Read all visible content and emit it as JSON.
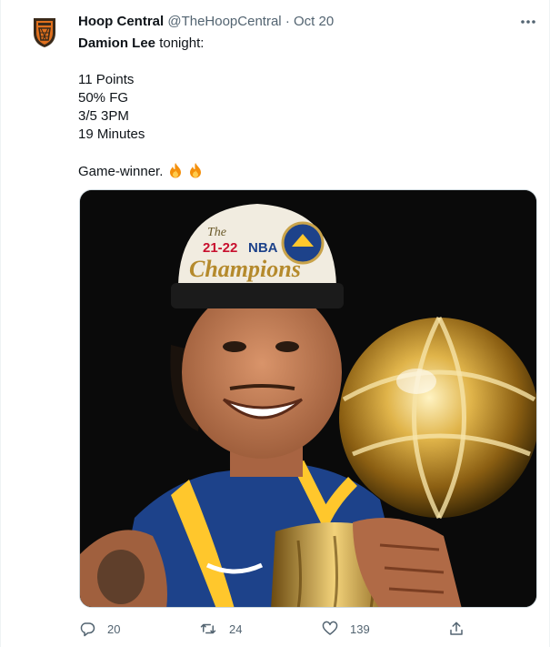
{
  "tweet": {
    "author_name": "Hoop Central",
    "handle": "@TheHoopCentral",
    "separator": "·",
    "date": "Oct 20",
    "mention": "Damion Lee",
    "intro_rest": " tonight:",
    "stats": [
      "11 Points",
      "50% FG",
      "3/5 3PM",
      "19 Minutes"
    ],
    "closing": "Game-winner.",
    "media": {
      "cap_line1": "The",
      "cap_line2": "21-22",
      "cap_line3": "NBA",
      "cap_script": "Champions"
    }
  },
  "actions": {
    "reply_count": "20",
    "retweet_count": "24",
    "like_count": "139"
  },
  "icons": {
    "avatar": "hoop-central-logo-icon",
    "more": "more-options-icon",
    "reply": "reply-icon",
    "retweet": "retweet-icon",
    "like": "heart-icon",
    "share": "share-icon",
    "emoji": "fire-emoji-icon"
  },
  "colors": {
    "text": "#0f1419",
    "muted": "#536471",
    "logo_orange": "#e0701e",
    "logo_dark": "#3a2a1a"
  }
}
